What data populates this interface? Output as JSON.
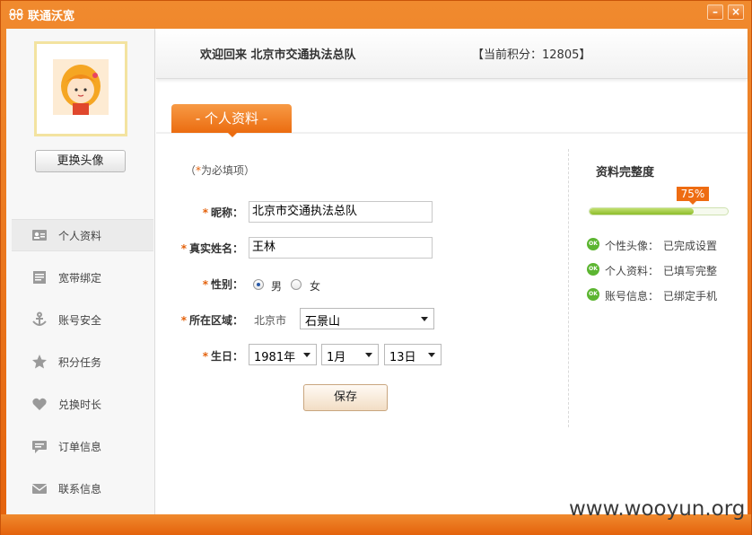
{
  "window": {
    "title": "联通沃宽",
    "min_glyph": "–",
    "close_glyph": "×"
  },
  "sidebar": {
    "change_avatar_label": "更换头像",
    "items": [
      {
        "label": "个人资料",
        "icon": "profile-card-icon",
        "active": true
      },
      {
        "label": "宽带绑定",
        "icon": "document-icon",
        "active": false
      },
      {
        "label": "账号安全",
        "icon": "anchor-icon",
        "active": false
      },
      {
        "label": "积分任务",
        "icon": "star-icon",
        "active": false
      },
      {
        "label": "兑换时长",
        "icon": "heart-icon",
        "active": false
      },
      {
        "label": "订单信息",
        "icon": "chat-bubble-icon",
        "active": false
      },
      {
        "label": "联系信息",
        "icon": "envelope-icon",
        "active": false
      }
    ]
  },
  "header": {
    "welcome": "欢迎回来 北京市交通执法总队",
    "points": "【当前积分：12805】"
  },
  "tabs": [
    {
      "label": "- 个人资料 -",
      "active": true
    }
  ],
  "form": {
    "required_hint_prefix": "（",
    "required_hint_star": "*",
    "required_hint_suffix": "为必填项）",
    "nickname_label": "昵称：",
    "nickname_value": "北京市交通执法总队",
    "realname_label": "真实姓名：",
    "realname_value": "王林",
    "gender_label": "性别：",
    "gender_male": "男",
    "gender_female": "女",
    "gender_selected": "男",
    "region_label": "所在区域：",
    "region_city": "北京市",
    "region_district": "石景山",
    "birthday_label": "生日：",
    "birth_year": "1981年",
    "birth_month": "1月",
    "birth_day": "13日",
    "save_label": "保存",
    "star": "*"
  },
  "completeness": {
    "title": "资料完整度",
    "percent_label": "75%",
    "percent": 0.75,
    "ok_label": "OK",
    "items": [
      {
        "name": "个性头像：",
        "status": "已完成设置"
      },
      {
        "name": "个人资料：",
        "status": "已填写完整"
      },
      {
        "name": "账号信息：",
        "status": "已绑定手机"
      }
    ]
  },
  "watermark": "www.wooyun.org",
  "colors": {
    "accent": "#e4620c",
    "ok_green": "#5cb531",
    "progress_green": "#8dbd2a"
  }
}
